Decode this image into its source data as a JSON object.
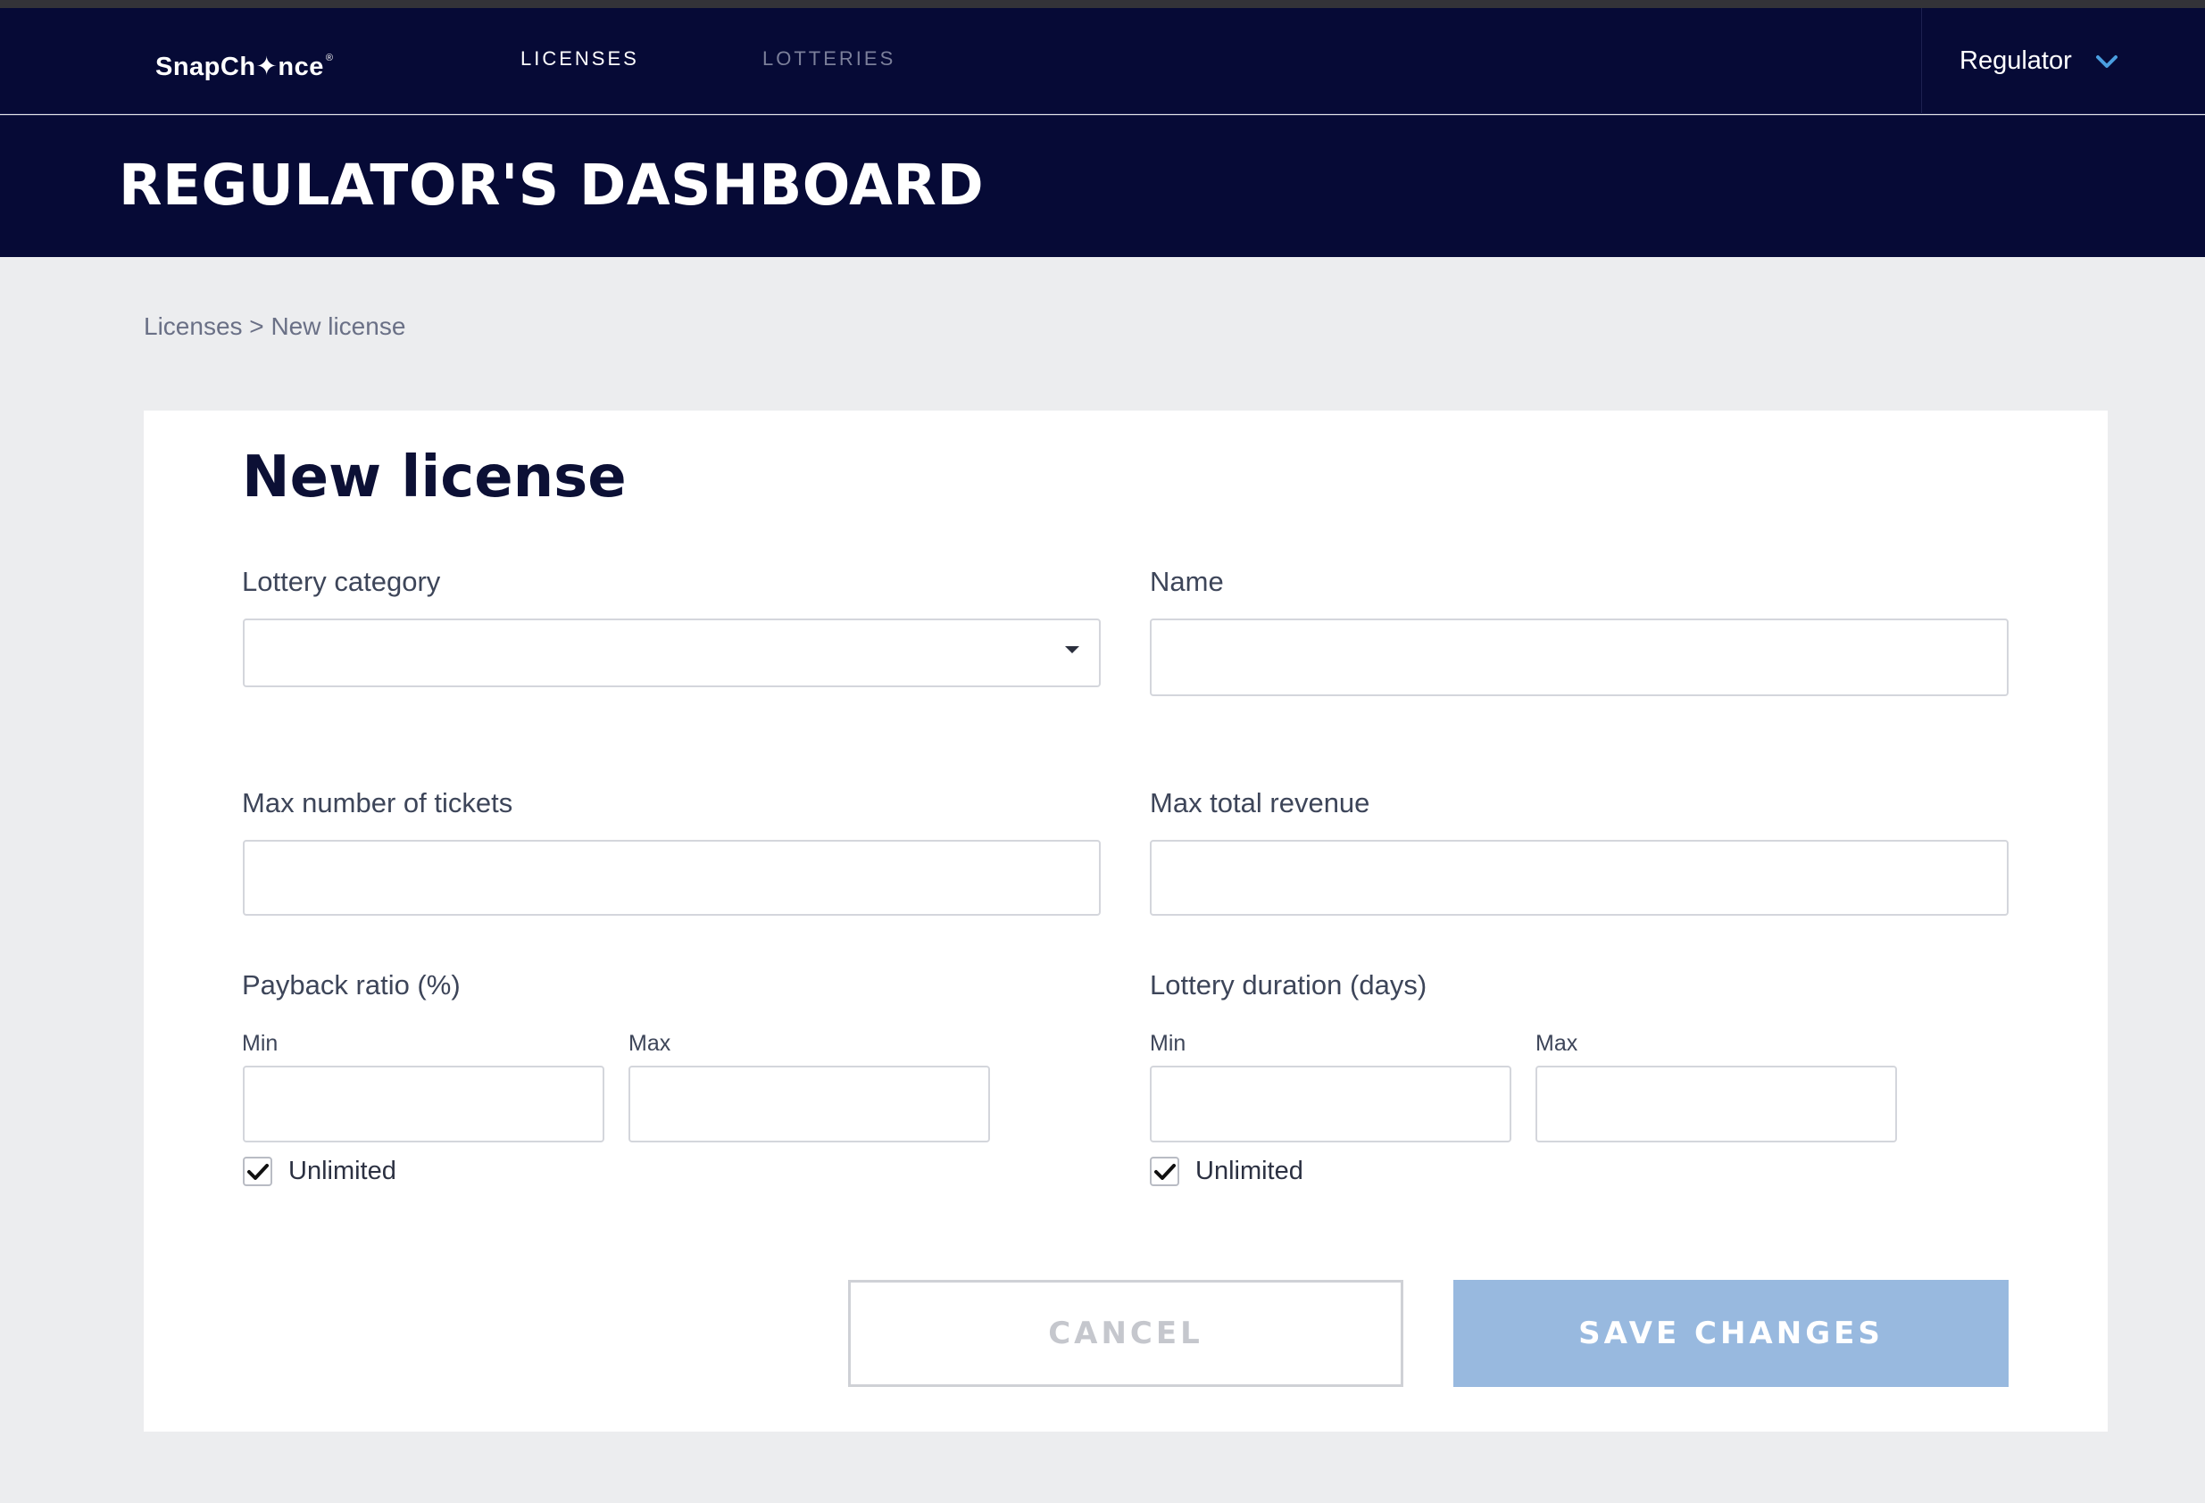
{
  "app": {
    "logo_text": "SnapCh✦nce",
    "logo_mark": "®"
  },
  "nav": {
    "links": [
      {
        "label": "LICENSES",
        "active": true
      },
      {
        "label": "LOTTERIES",
        "active": false
      }
    ],
    "user_label": "Regulator"
  },
  "header": {
    "title": "REGULATOR'S DASHBOARD"
  },
  "breadcrumb": {
    "parent": "Licenses",
    "separator": " > ",
    "current": "New license"
  },
  "form": {
    "title": "New license",
    "lottery_category": {
      "label": "Lottery category",
      "value": ""
    },
    "name": {
      "label": "Name",
      "value": ""
    },
    "max_tickets": {
      "label": "Max number of tickets",
      "value": ""
    },
    "max_revenue": {
      "label": "Max total revenue",
      "value": ""
    },
    "payback_ratio": {
      "label": "Payback ratio (%)",
      "min_label": "Min",
      "max_label": "Max",
      "min_value": "",
      "max_value": "",
      "unlimited_label": "Unlimited",
      "unlimited_checked": true
    },
    "lottery_duration": {
      "label": "Lottery duration (days)",
      "min_label": "Min",
      "max_label": "Max",
      "min_value": "",
      "max_value": "",
      "unlimited_label": "Unlimited",
      "unlimited_checked": true
    },
    "cancel_label": "CANCEL",
    "save_label": "SAVE CHANGES"
  },
  "colors": {
    "nav_bg": "#060a36",
    "page_bg": "#ecedef",
    "save_button": "#98b9df",
    "chevron_accent": "#4a9ee0"
  },
  "icons": {
    "user_menu": "chevron-down-icon",
    "select": "caret-down-icon",
    "checkbox": "checkmark-icon"
  }
}
